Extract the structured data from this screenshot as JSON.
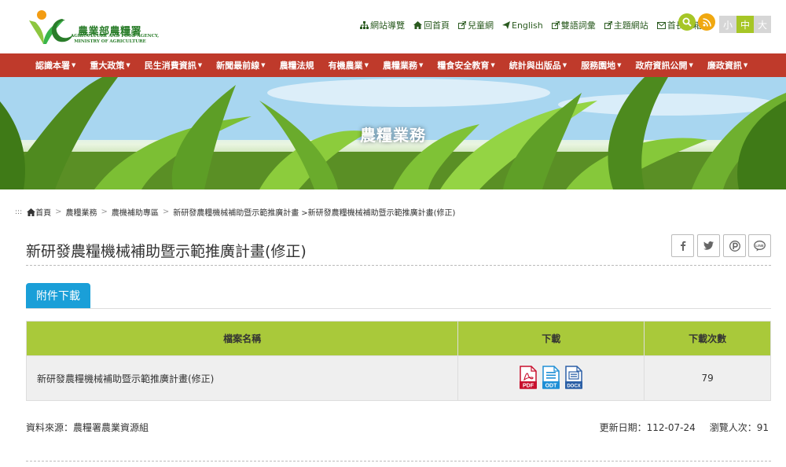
{
  "header": {
    "logo_cn": "農業部農糧署",
    "logo_en": "AGRICULTURE AND FOOD AGENCY,\nMINISTRY OF AGRICULTURE",
    "top_links": [
      {
        "label": "網站導覽",
        "icon": "sitemap-icon"
      },
      {
        "label": "回首頁",
        "icon": "home-icon"
      },
      {
        "label": "兒童網",
        "icon": "external-link-icon"
      },
      {
        "label": "English",
        "icon": "send-icon"
      },
      {
        "label": "雙語詞彙",
        "icon": "external-link-icon"
      },
      {
        "label": "主題網站",
        "icon": "external-link-icon"
      },
      {
        "label": "首長信箱",
        "icon": "envelope-icon"
      }
    ],
    "font_sizes": [
      "小",
      "中",
      "大"
    ]
  },
  "nav": {
    "items": [
      {
        "label": "認識本署",
        "dropdown": true
      },
      {
        "label": "重大政策",
        "dropdown": true
      },
      {
        "label": "民生消費資訊",
        "dropdown": true
      },
      {
        "label": "新聞最前線",
        "dropdown": true
      },
      {
        "label": "農糧法規",
        "dropdown": false
      },
      {
        "label": "有機農業",
        "dropdown": true
      },
      {
        "label": "農糧業務",
        "dropdown": true
      },
      {
        "label": "糧食安全教育",
        "dropdown": true
      },
      {
        "label": "統計與出版品",
        "dropdown": true
      },
      {
        "label": "服務園地",
        "dropdown": true
      },
      {
        "label": "政府資訊公開",
        "dropdown": true
      },
      {
        "label": "廉政資訊",
        "dropdown": true
      }
    ]
  },
  "banner": {
    "title": "農糧業務"
  },
  "breadcrumb": {
    "marker": ":::",
    "home": "首頁",
    "items": [
      "農糧業務",
      "農機補助專區",
      "新研發農糧機械補助暨示範推廣計畫"
    ],
    "current": ">新研發農糧機械補助暨示範推廣計畫(修正)"
  },
  "page": {
    "title": "新研發農糧機械補助暨示範推廣計畫(修正)",
    "tab_label": "附件下載"
  },
  "table": {
    "headers": [
      "檔案名稱",
      "下載",
      "下載次數"
    ],
    "rows": [
      {
        "name": "新研發農糧機械補助暨示範推廣計畫(修正)",
        "formats": [
          "PDF",
          "ODT",
          "DOCX"
        ],
        "downloads": "79"
      }
    ]
  },
  "footer": {
    "source": "資料來源：農糧署農業資源組",
    "updated": "更新日期：112-07-24",
    "views": "瀏覽人次：91"
  },
  "colors": {
    "nav_bg": "#bf3a2b",
    "table_header": "#a9c93a",
    "tab_bg": "#1a9fd8",
    "logo_green": "#2a7d2a"
  }
}
